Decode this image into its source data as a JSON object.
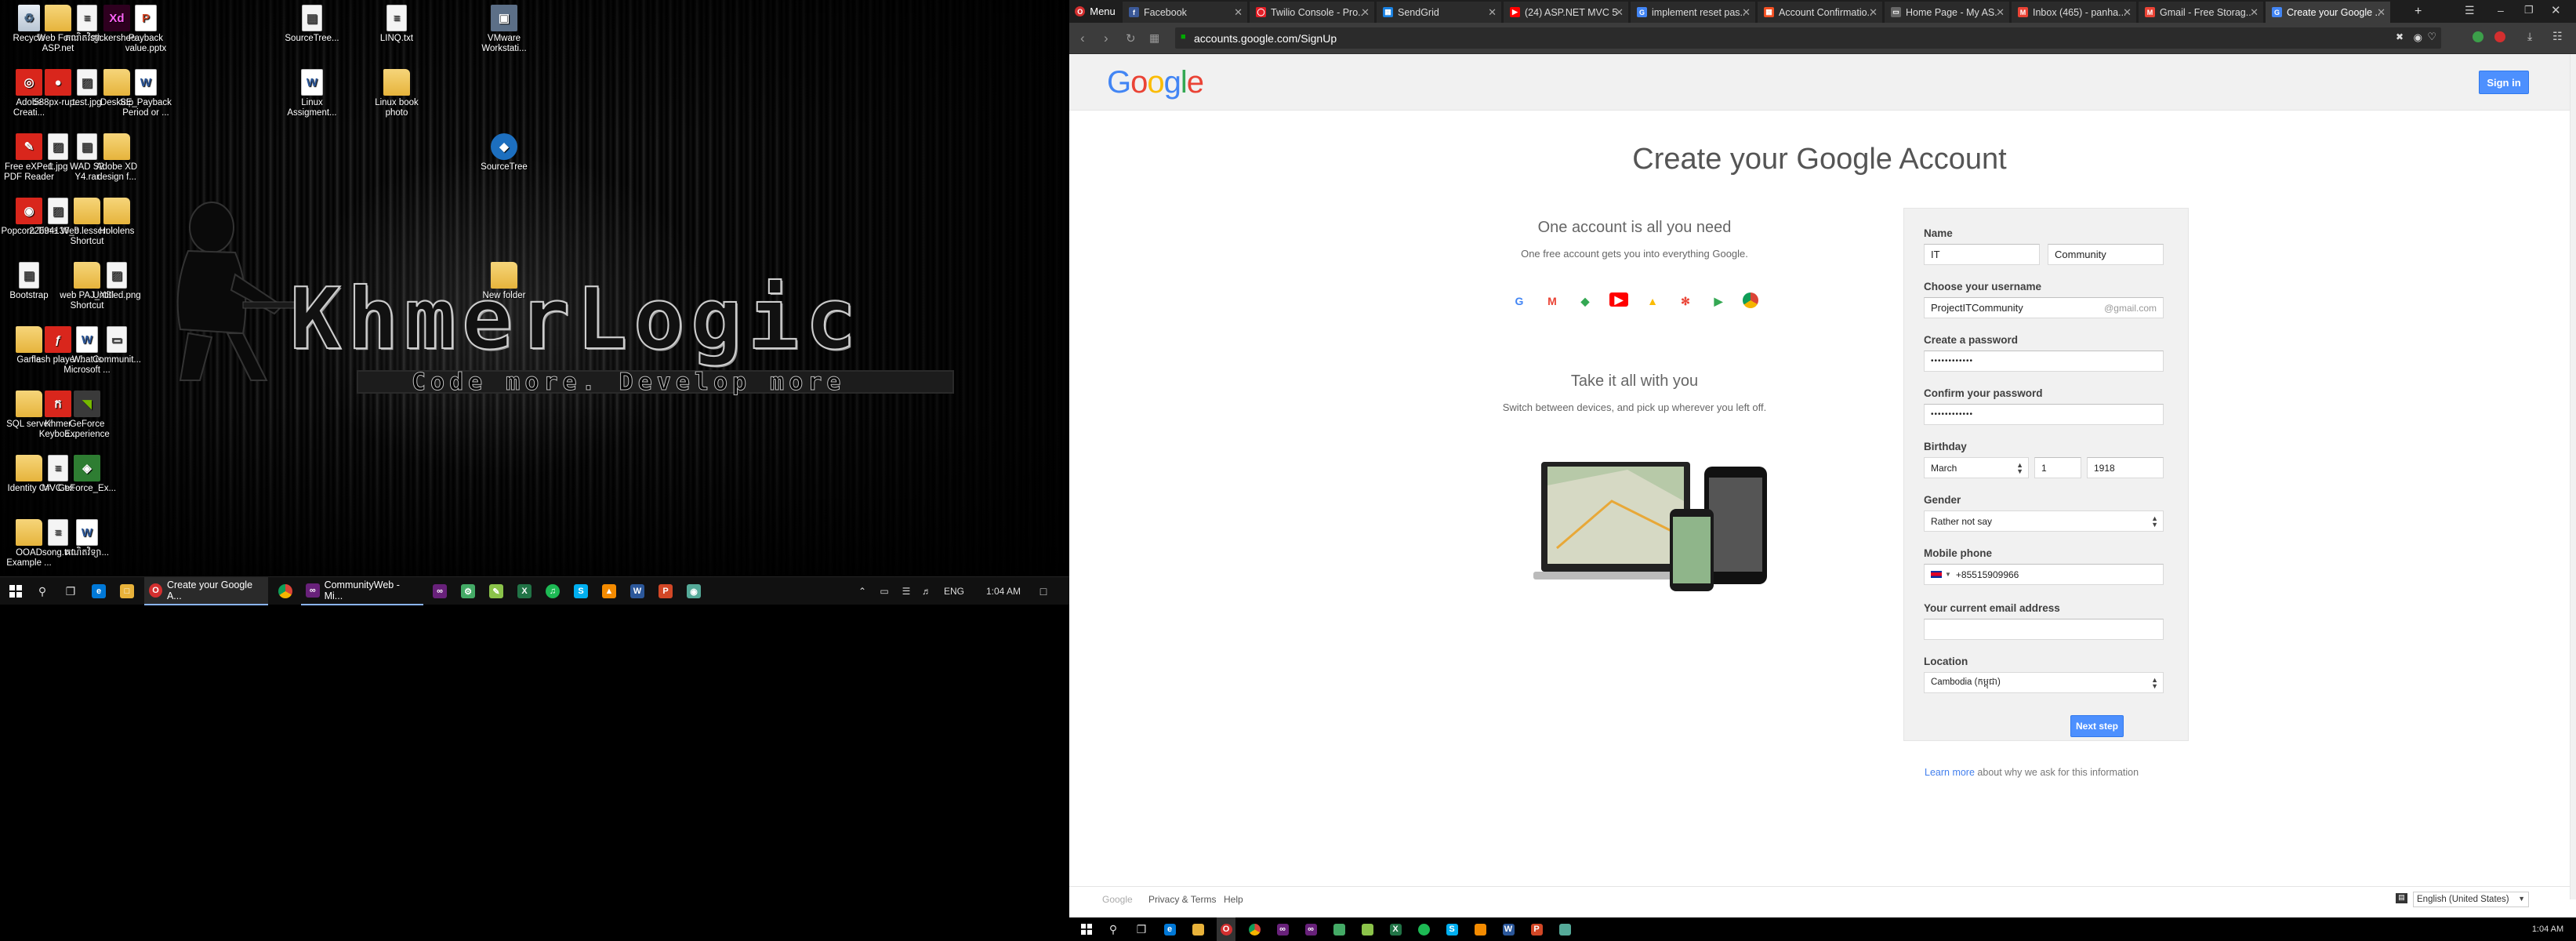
{
  "desktop": {
    "icons": [
      {
        "label": "Recycle",
        "style": "recycle",
        "glyph": "♻"
      },
      {
        "label": "Web Form ASP.net",
        "style": "folder",
        "glyph": ""
      },
      {
        "label": "គណិតវិទ្យា...",
        "style": "file",
        "glyph": "≡"
      },
      {
        "label": "stickershee...",
        "style": "xd",
        "glyph": "Xd"
      },
      {
        "label": "Payback value.pptx",
        "style": "ppt",
        "glyph": "P"
      },
      {
        "label": "SourceTree...",
        "style": "file",
        "glyph": "▦"
      },
      {
        "label": "LINQ.txt",
        "style": "file",
        "glyph": "≡"
      },
      {
        "label": "VMware Workstati...",
        "style": "vm",
        "glyph": "▣"
      },
      {
        "label": "Adobe Creati...",
        "style": "red",
        "glyph": "◎"
      },
      {
        "label": "588px-rup...",
        "style": "red",
        "glyph": "●"
      },
      {
        "label": "test.jpg",
        "style": "file",
        "glyph": "▨"
      },
      {
        "label": "Desktop",
        "style": "folder",
        "glyph": ""
      },
      {
        "label": "SE_Payback Period or ...",
        "style": "word",
        "glyph": "W"
      },
      {
        "label": "Linux Assigment...",
        "style": "word",
        "glyph": "W"
      },
      {
        "label": "Linux book photo",
        "style": "folder",
        "glyph": ""
      },
      {
        "label": "Free eXPert PDF Reader",
        "style": "red",
        "glyph": "✎"
      },
      {
        "label": "1.jpg",
        "style": "file",
        "glyph": "▨"
      },
      {
        "label": "WAD S2 Y4.rar",
        "style": "file",
        "glyph": "▤"
      },
      {
        "label": "Adobe XD design f...",
        "style": "folder",
        "glyph": ""
      },
      {
        "label": "SourceTree",
        "style": "st",
        "glyph": "◆"
      },
      {
        "label": "Popcorn Time",
        "style": "red",
        "glyph": "◉"
      },
      {
        "label": "22694136_9...",
        "style": "file",
        "glyph": "▨"
      },
      {
        "label": "Web lesson - Shortcut",
        "style": "folder",
        "glyph": ""
      },
      {
        "label": "Hololens",
        "style": "folder",
        "glyph": ""
      },
      {
        "label": "Bootstrap",
        "style": "file",
        "glyph": "▤"
      },
      {
        "label": "web PAJ_XSI Shortcut",
        "style": "folder",
        "glyph": ""
      },
      {
        "label": "Untitled.png",
        "style": "file",
        "glyph": "▨"
      },
      {
        "label": "New folder",
        "style": "folder",
        "glyph": ""
      },
      {
        "label": "Game",
        "style": "folder",
        "glyph": ""
      },
      {
        "label": "flash player...",
        "style": "red",
        "glyph": "ƒ"
      },
      {
        "label": "What is Microsoft ...",
        "style": "word",
        "glyph": "W"
      },
      {
        "label": "Communit...",
        "style": "file",
        "glyph": "▭"
      },
      {
        "label": "SQL server",
        "style": "folder",
        "glyph": ""
      },
      {
        "label": "Khmer Keyboa...",
        "style": "red",
        "glyph": "ក"
      },
      {
        "label": "GeForce Experience",
        "style": "nv",
        "glyph": "◥"
      },
      {
        "label": "Identity C#",
        "style": "folder",
        "glyph": ""
      },
      {
        "label": "MVC.txt",
        "style": "file",
        "glyph": "≡"
      },
      {
        "label": "GeForce_Ex...",
        "style": "green",
        "glyph": "◈"
      },
      {
        "label": "OOAD Example ...",
        "style": "folder",
        "glyph": ""
      },
      {
        "label": "song.txt",
        "style": "file",
        "glyph": "≡"
      },
      {
        "label": "គណិតវិទ្យា...",
        "style": "word",
        "glyph": "W"
      }
    ],
    "wallpaper_title": "KhmerLogic",
    "wallpaper_subtitle": "Code more. Develop more"
  },
  "left_taskbar": {
    "active_task": "Create your Google A...",
    "task2": "CommunityWeb - Mi...",
    "lang": "ENG",
    "time": "1:04 AM"
  },
  "browser": {
    "menu_label": "Menu",
    "tabs": [
      {
        "label": "Facebook",
        "color": "#3b5998",
        "glyph": "f"
      },
      {
        "label": "Twilio Console - Pro...",
        "color": "#e31e26",
        "glyph": "◯"
      },
      {
        "label": "SendGrid",
        "color": "#1a82e2",
        "glyph": "▦"
      },
      {
        "label": "(24) ASP.NET MVC 5...",
        "color": "#ff0000",
        "glyph": "▶"
      },
      {
        "label": "implement reset pas...",
        "color": "#4285f4",
        "glyph": "G"
      },
      {
        "label": "Account Confirmatio...",
        "color": "#f25022",
        "glyph": "▦"
      },
      {
        "label": "Home Page - My AS...",
        "color": "#666666",
        "glyph": "▭"
      },
      {
        "label": "Inbox (465) - panha...",
        "color": "#ea4335",
        "glyph": "M"
      },
      {
        "label": "Gmail - Free Storag...",
        "color": "#ea4335",
        "glyph": "M"
      },
      {
        "label": "Create your Google ...",
        "color": "#4285f4",
        "glyph": "G"
      }
    ],
    "url": "accounts.google.com/SignUp"
  },
  "google": {
    "signin_label": "Sign in",
    "title": "Create your Google Account",
    "left_heading1": "One account is all you need",
    "left_sub1": "One free account gets you into everything Google.",
    "left_heading2": "Take it all with you",
    "left_sub2": "Switch between devices, and pick up wherever you left off.",
    "form": {
      "name_label": "Name",
      "first_name": "IT",
      "last_name": "Community",
      "username_label": "Choose your username",
      "username": "ProjectITCommunity",
      "username_suffix": "@gmail.com",
      "password_label": "Create a password",
      "password": "••••••••••••",
      "confirm_label": "Confirm your password",
      "confirm": "••••••••••••",
      "birthday_label": "Birthday",
      "birth_month": "March",
      "birth_day": "1",
      "birth_year": "1918",
      "gender_label": "Gender",
      "gender": "Rather not say",
      "phone_label": "Mobile phone",
      "phone": "+85515909966",
      "email_label": "Your current email address",
      "email": "",
      "location_label": "Location",
      "location": "Cambodia (កម្ពុជា)",
      "next_label": "Next step"
    },
    "learn_more_link": "Learn more",
    "learn_more_text": " about why we ask for this information",
    "footer": {
      "google": "Google",
      "privacy": "Privacy & Terms",
      "help": "Help",
      "language": "English (United States)"
    }
  },
  "right_taskbar": {
    "time": "1:04 AM"
  }
}
